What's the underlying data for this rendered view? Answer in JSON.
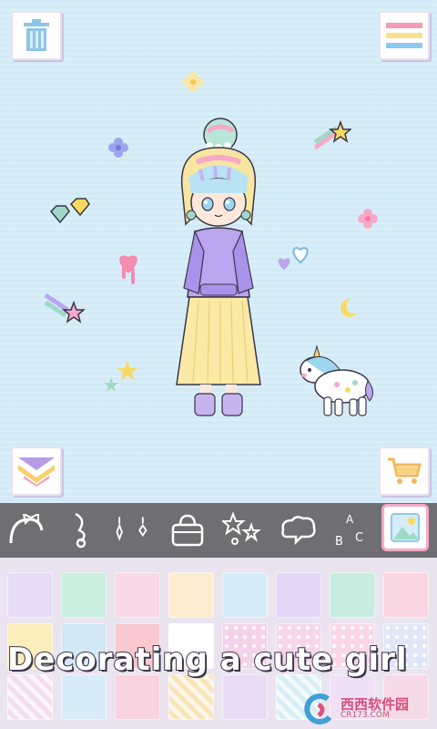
{
  "stage": {
    "background": "#d3ebf7",
    "trash_button_icon": "trash-can-icon",
    "menu_button_icon": "hamburger-menu-icon",
    "collapse_button_icon": "chevron-down-icon",
    "shop_button_icon": "shopping-cart-icon"
  },
  "toolbar": {
    "background": "#6f6f73",
    "tools": [
      {
        "icon": "headband-icon"
      },
      {
        "icon": "hair-bangs-icon"
      },
      {
        "icon": "earrings-icon"
      },
      {
        "icon": "handbag-icon"
      },
      {
        "icon": "sparkle-stickers-icon"
      },
      {
        "icon": "speech-bubble-icon"
      },
      {
        "icon": "letters-icon",
        "text": "A B C"
      },
      {
        "icon": "background-image-icon",
        "selected": true
      }
    ]
  },
  "palette": {
    "row1_colors": [
      "#e7dcf7",
      "#c9efe0",
      "#fbd8e6",
      "#fcecd0",
      "#d6ecf8",
      "#e4d6f6",
      "#c7ece0",
      "#f9d5e2"
    ],
    "row2_colors": [
      "#fbeebd",
      "#d3e8f5",
      "#f9c9cf",
      "#ffffff",
      "#f3d2ea",
      "#f6d6ea",
      "#f9d7e7",
      "#dee6f7"
    ],
    "row3_colors": [
      "#f4dcef",
      "#d7ecf6",
      "#f9d3df",
      "#f8e4b8",
      "#e9dcf4",
      "#d8eef6",
      "#efe0f5",
      "#f6dae8"
    ]
  },
  "banner": {
    "text": "Decorating a cute girl"
  },
  "watermark": {
    "text": "西西软件园",
    "sub": "CR173.COM"
  }
}
